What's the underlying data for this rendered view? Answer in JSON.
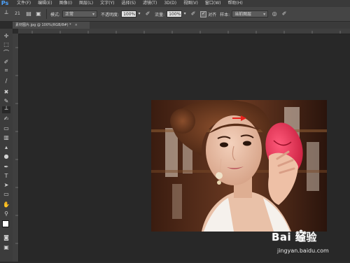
{
  "app": {
    "logo": "Ps"
  },
  "menu": [
    "文件(F)",
    "编辑(E)",
    "图像(I)",
    "图层(L)",
    "文字(Y)",
    "选择(S)",
    "滤镜(T)",
    "3D(D)",
    "视图(V)",
    "窗口(W)",
    "帮助(H)"
  ],
  "options": {
    "brush_size": "21",
    "mode_label": "模式:",
    "mode_value": "正常",
    "opacity_label": "不透明度:",
    "opacity_value": "100%",
    "flow_label": "流量:",
    "flow_value": "100%",
    "aligned_label": "对齐",
    "aligned_checked": "✓",
    "sample_label": "样本:",
    "sample_value": "当前图层"
  },
  "document": {
    "tab_title": "素材图片.jpg @ 100%(RGB/8#) *",
    "close": "×"
  },
  "watermark": {
    "logo": "Bai  经验",
    "url": "jingyan.baidu.com"
  },
  "colors": {
    "panel": "#3c3c3c",
    "canvas": "#282828",
    "accent": "#4ea4ff",
    "arrow": "#e8231e"
  }
}
